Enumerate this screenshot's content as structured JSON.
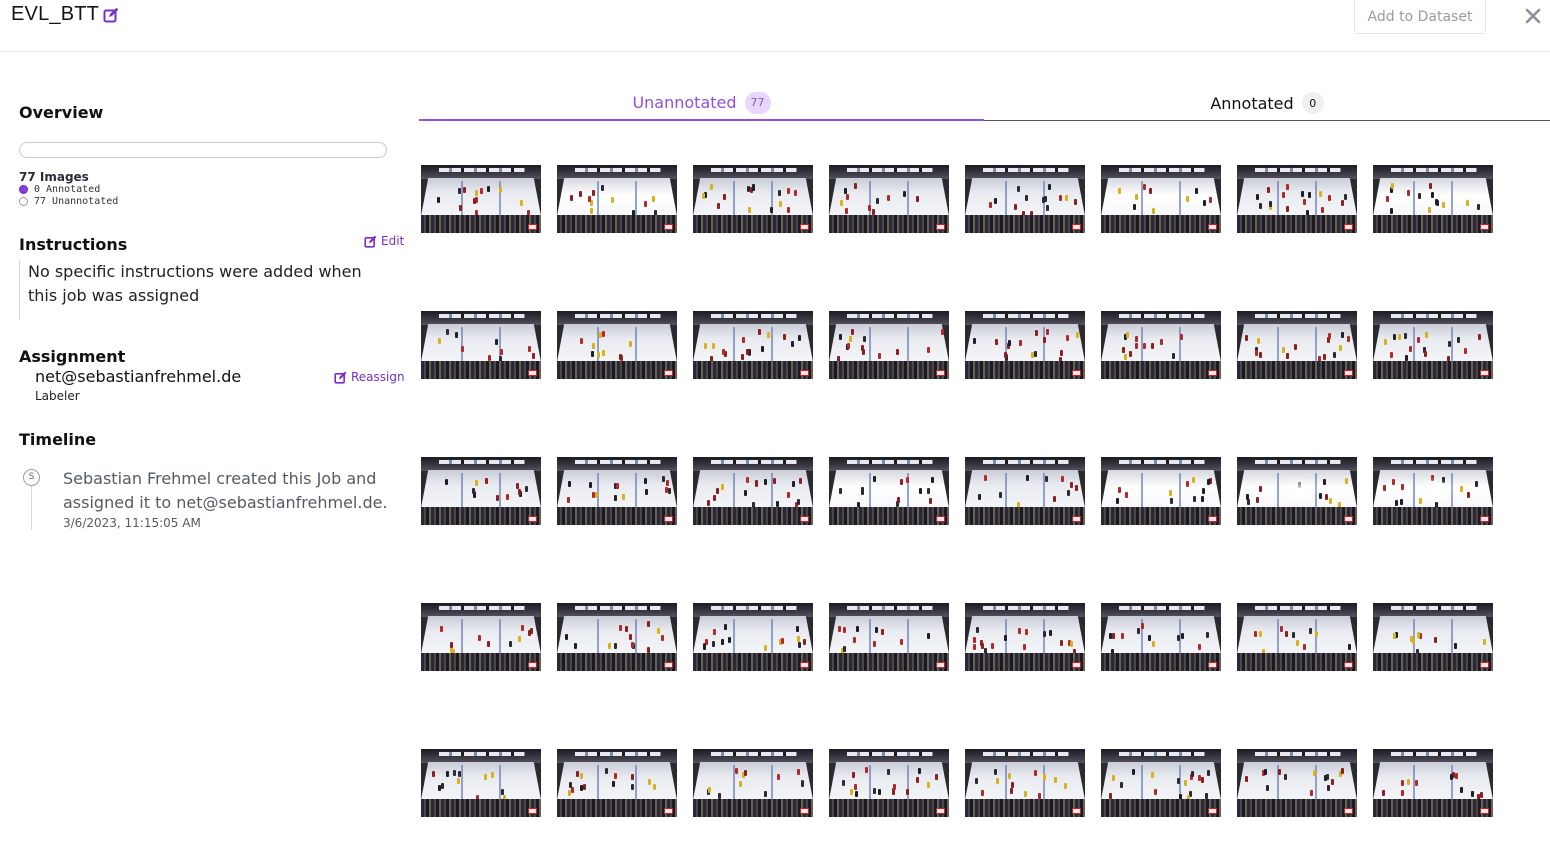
{
  "header": {
    "job_title": "EVL_BTT",
    "add_to_dataset_label": "Add to Dataset"
  },
  "overview": {
    "heading": "Overview",
    "progress_fraction": 0,
    "images_label": "77 Images",
    "annotated_label": "0 Annotated",
    "unannotated_label": "77 Unannotated"
  },
  "instructions": {
    "heading": "Instructions",
    "edit_label": "Edit",
    "text": "No specific instructions were added when this job was assigned"
  },
  "assignment": {
    "heading": "Assignment",
    "assignee": "net@sebastianfrehmel.de",
    "role": "Labeler",
    "reassign_label": "Reassign"
  },
  "timeline": {
    "heading": "Timeline",
    "avatar_initial": "S",
    "event_text": "Sebastian Frehmel created this Job and assigned it to net@sebastianfrehmel.de.",
    "event_time": "3/6/2023, 11:15:05 AM"
  },
  "tabs": [
    {
      "label": "Unannotated",
      "count": "77",
      "active": true
    },
    {
      "label": "Annotated",
      "count": "0",
      "active": false
    }
  ],
  "colors": {
    "accent": "#9150d9",
    "accent_dark": "#7a2fc5",
    "badge_bg": "#e7d8fb"
  },
  "thumbnails": {
    "visible_count": 40,
    "columns": 8,
    "variants": [
      "normal",
      "bright",
      "normal",
      "normal",
      "normal",
      "bright",
      "normal",
      "bright",
      "normal",
      "normal",
      "normal",
      "normal",
      "normal",
      "normal",
      "normal",
      "normal",
      "normal",
      "normal",
      "normal",
      "bright",
      "normal",
      "bright",
      "glow",
      "glow",
      "normal",
      "normal",
      "normal",
      "normal",
      "normal",
      "normal",
      "normal",
      "normal",
      "normal",
      "normal",
      "normal",
      "normal",
      "normal",
      "normal",
      "normal",
      "normal"
    ]
  }
}
